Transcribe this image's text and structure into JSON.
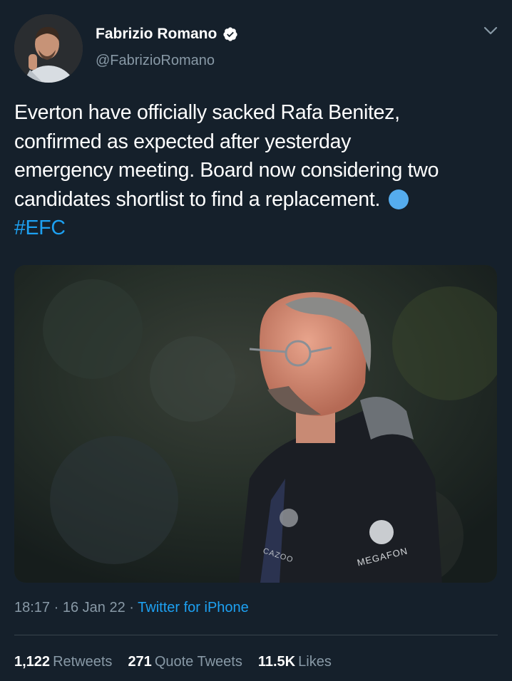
{
  "tweet": {
    "author": {
      "display_name": "Fabrizio Romano",
      "handle": "@FabrizioRomano",
      "verified": true
    },
    "text_lines": [
      "Everton have officially sacked Rafa Benitez,",
      "confirmed as expected after yesterday",
      "emergency meeting. Board now considering two",
      "candidates shortlist to find a replacement."
    ],
    "hashtag": "#EFC",
    "media": {
      "jacket_brand_left": "CAZOO",
      "jacket_brand_right": "MEGAFON"
    },
    "meta": {
      "time": "18:17",
      "date": "16 Jan 22",
      "separator": "·",
      "source": "Twitter for iPhone"
    },
    "stats": {
      "retweets_count": "1,122",
      "retweets_label": "Retweets",
      "quotes_count": "271",
      "quotes_label": "Quote Tweets",
      "likes_count": "11.5K",
      "likes_label": "Likes"
    }
  },
  "colors": {
    "background": "#15202b",
    "accent": "#1da1f2",
    "secondary_text": "#8899a6",
    "divider": "#38444d",
    "emoji_circle": "#55acee"
  },
  "icons": [
    "verified-badge-icon",
    "chevron-down-icon",
    "blue-circle-emoji"
  ]
}
